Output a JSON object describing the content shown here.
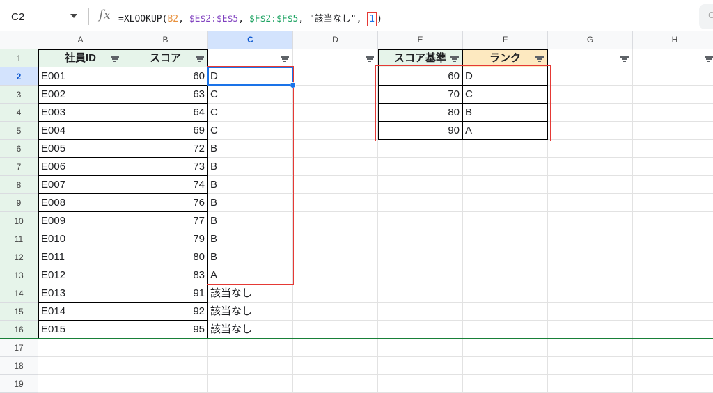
{
  "formula_bar": {
    "cell_ref": "C2",
    "fx_label": "fx",
    "formula": {
      "prefix": "=XLOOKUP(",
      "arg1": "B2",
      "sep1": ", ",
      "arg2": "$E$2:$E$5",
      "sep2": ", ",
      "arg3": "$F$2:$F$5",
      "sep3": ", ",
      "arg4": "\"該当なし\"",
      "sep4": ", ",
      "arg5": "1",
      "suffix": ")"
    },
    "edge_button": "G"
  },
  "columns": [
    "A",
    "B",
    "C",
    "D",
    "E",
    "F",
    "G",
    "H"
  ],
  "rows": [
    "1",
    "2",
    "3",
    "4",
    "5",
    "6",
    "7",
    "8",
    "9",
    "10",
    "11",
    "12",
    "13",
    "14",
    "15",
    "16",
    "17",
    "18",
    "19"
  ],
  "headers": {
    "a": "社員ID",
    "b": "スコア",
    "e": "スコア基準",
    "f": "ランク"
  },
  "employees": [
    {
      "id": "E001",
      "score": "60",
      "rank": "D"
    },
    {
      "id": "E002",
      "score": "63",
      "rank": "C"
    },
    {
      "id": "E003",
      "score": "64",
      "rank": "C"
    },
    {
      "id": "E004",
      "score": "69",
      "rank": "C"
    },
    {
      "id": "E005",
      "score": "72",
      "rank": "B"
    },
    {
      "id": "E006",
      "score": "73",
      "rank": "B"
    },
    {
      "id": "E007",
      "score": "74",
      "rank": "B"
    },
    {
      "id": "E008",
      "score": "76",
      "rank": "B"
    },
    {
      "id": "E009",
      "score": "77",
      "rank": "B"
    },
    {
      "id": "E010",
      "score": "79",
      "rank": "B"
    },
    {
      "id": "E011",
      "score": "80",
      "rank": "B"
    },
    {
      "id": "E012",
      "score": "83",
      "rank": "A"
    },
    {
      "id": "E013",
      "score": "91",
      "rank": "該当なし"
    },
    {
      "id": "E014",
      "score": "92",
      "rank": "該当なし"
    },
    {
      "id": "E015",
      "score": "95",
      "rank": "該当なし"
    }
  ],
  "criteria": [
    {
      "threshold": "60",
      "rank": "D"
    },
    {
      "threshold": "70",
      "rank": "C"
    },
    {
      "threshold": "80",
      "rank": "B"
    },
    {
      "threshold": "90",
      "rank": "A"
    }
  ],
  "colors": {
    "header_green": "#e6f4ea",
    "header_orange": "#fde9c0",
    "selection_blue": "#1a73e8",
    "highlight_red": "#e53935"
  }
}
